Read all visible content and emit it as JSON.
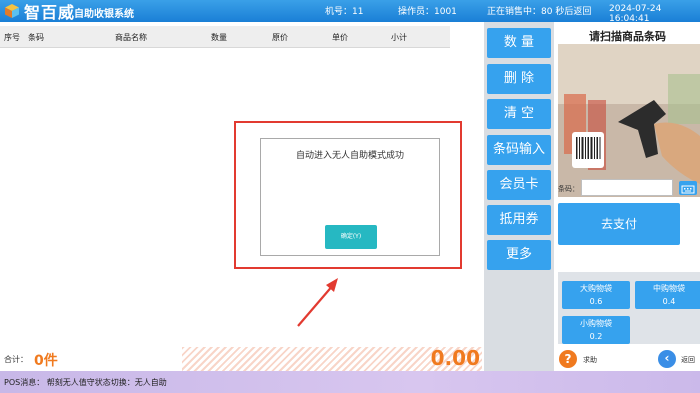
{
  "titlebar": {
    "brand": "智百威",
    "brand_sub": "自助收银系统",
    "machine": "机号：11",
    "operator": "操作员：1001",
    "selling": "正在销售中：80  秒后返回",
    "datetime": "2024-07-24 16:04:41"
  },
  "table": {
    "headers": [
      "序号",
      "条码",
      "商品名称",
      "数量",
      "原价",
      "单价",
      "小计"
    ]
  },
  "dialog": {
    "message": "自动进入无人自助模式成功",
    "ok_label": "确定(Y)"
  },
  "totals": {
    "label": "合计：",
    "count": "0件",
    "amount": "0.00"
  },
  "side_buttons": [
    "数 量",
    "删 除",
    "清 空",
    "条码输入",
    "会员卡",
    "抵用券",
    "更多"
  ],
  "scan": {
    "title": "请扫描商品条码",
    "barcode_label": "条码：",
    "barcode_value": "",
    "pay_label": "去支付",
    "bags": [
      {
        "name": "大购物袋",
        "price": "0.6"
      },
      {
        "name": "中购物袋",
        "price": "0.4"
      },
      {
        "name": "小购物袋",
        "price": "0.2"
      }
    ],
    "help_label": "求助",
    "back_label": "返回"
  },
  "status": {
    "text": "POS消息：  帮刻无人值守状态切换：无人自助"
  },
  "colors": {
    "accent_blue": "#36a2ee",
    "orange": "#f07a1f",
    "dialog_outline": "#e23a30",
    "ok_button": "#26b8c2"
  }
}
